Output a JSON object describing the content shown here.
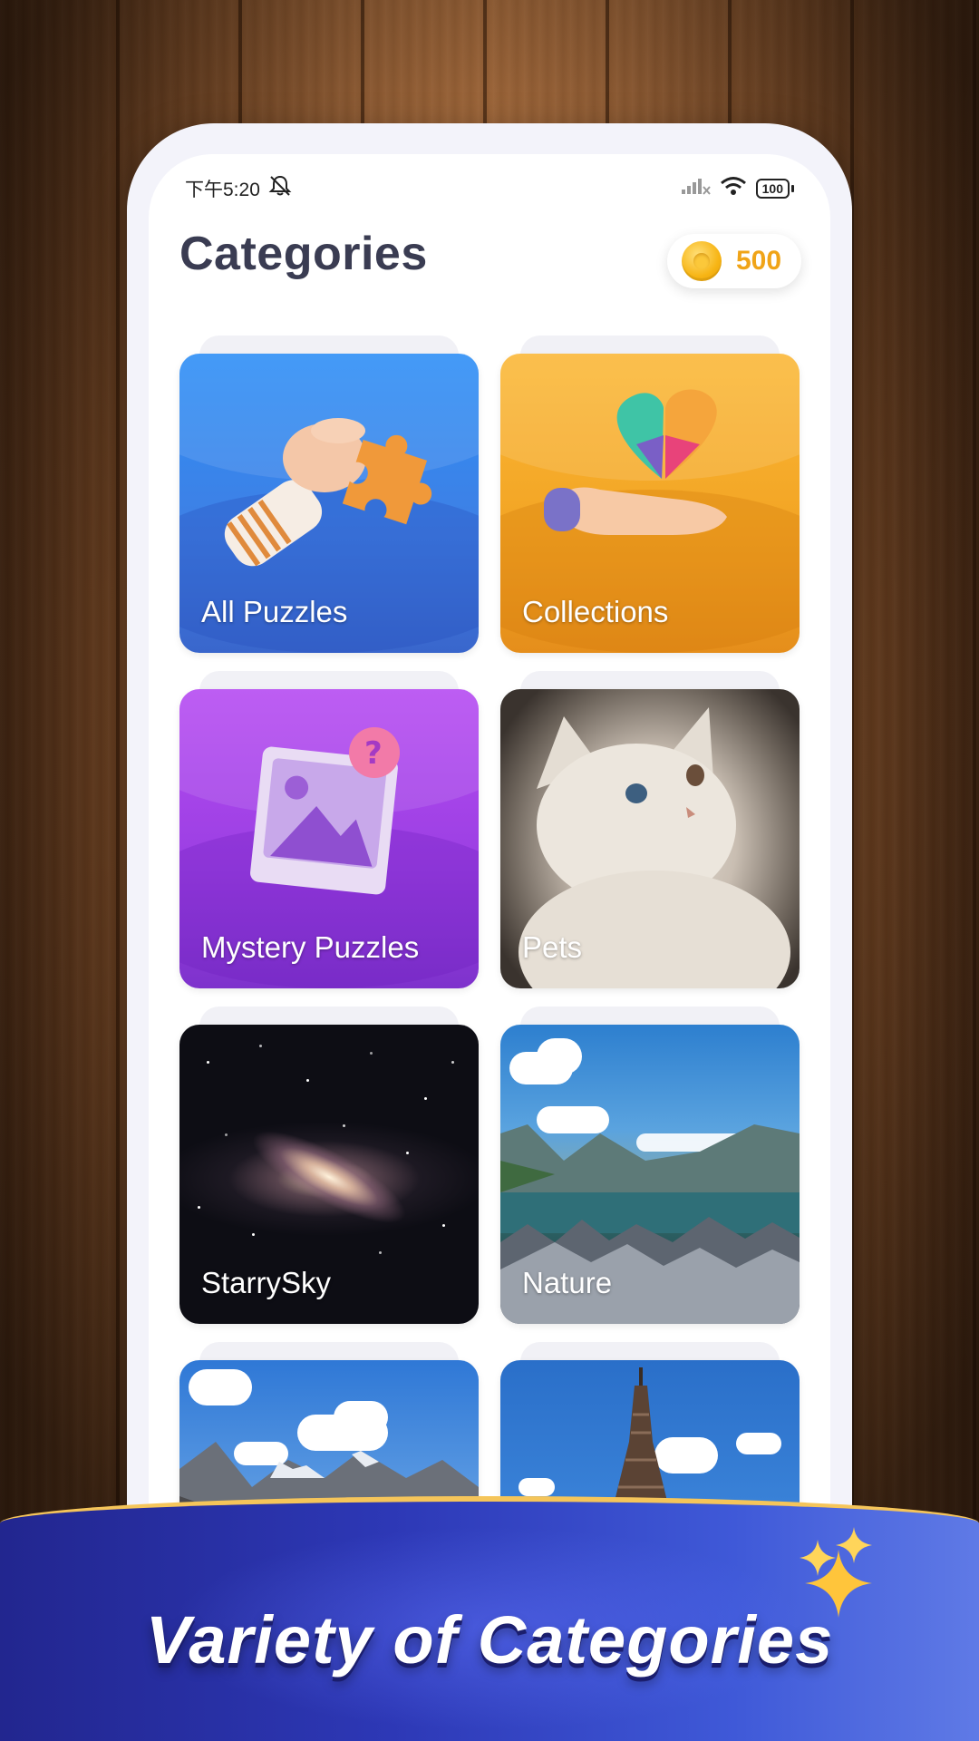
{
  "status_bar": {
    "time": "下午5:20",
    "battery": "100"
  },
  "header": {
    "title": "Categories",
    "coins": "500"
  },
  "categories": [
    {
      "label": "All Puzzles"
    },
    {
      "label": "Collections"
    },
    {
      "label": "Mystery Puzzles"
    },
    {
      "label": "Pets"
    },
    {
      "label": "StarrySky"
    },
    {
      "label": "Nature"
    },
    {
      "label": ""
    },
    {
      "label": ""
    }
  ],
  "banner": {
    "text": "Variety of Categories"
  },
  "colors": {
    "title": "#3a3c52",
    "coin": "#f0a418",
    "all_puzzles": "#3385f0",
    "collections": "#f5aa2a",
    "mystery": "#a445ea",
    "banner": "#2d38b6"
  }
}
